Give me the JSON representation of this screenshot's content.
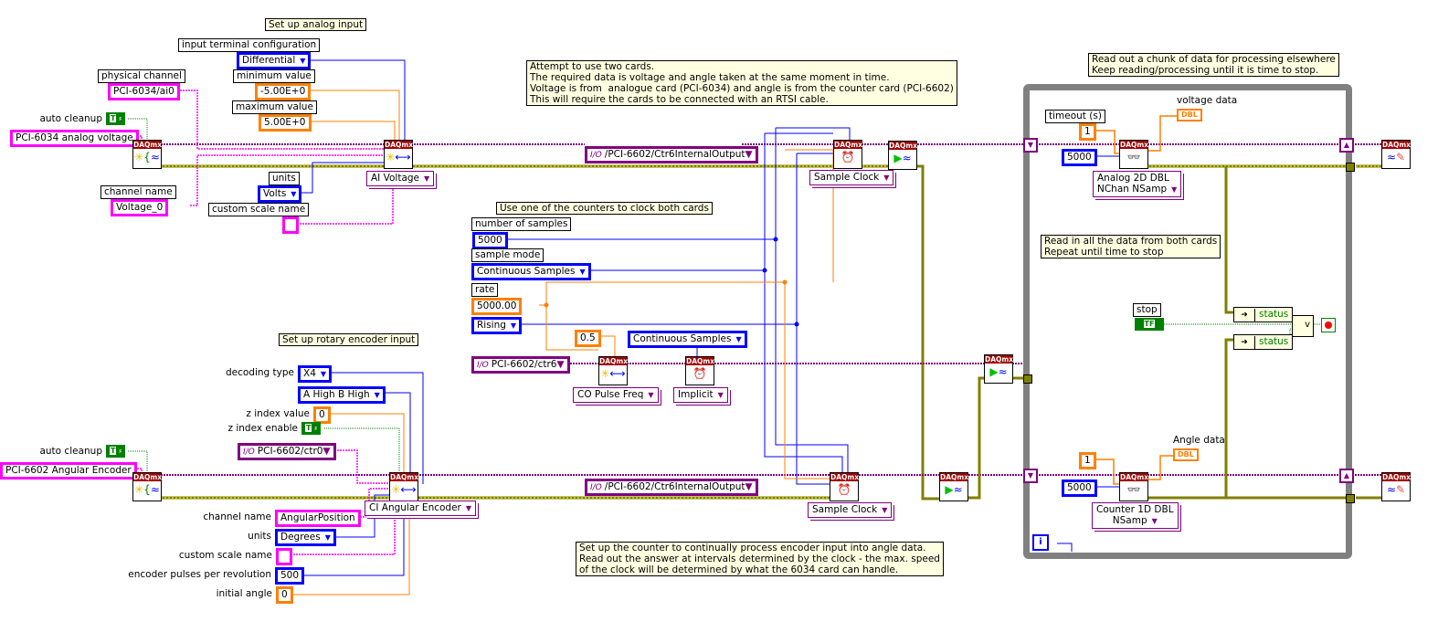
{
  "comments": {
    "setup_analog": "Set up analog input",
    "attempt": "Attempt to use two cards.\nThe required data is voltage and angle taken at the same moment in time.\nVoltage is from  analogue card (PCI-6034) and angle is from the counter card (PCI-6602)\nThis will require the cards to be connected with an RTSI cable.",
    "use_counters": "Use one of the counters to clock both cards",
    "setup_encoder": "Set up rotary encoder input",
    "counter_process": "Set up the counter to continually process encoder input into angle data.\nRead out the answer at intervals determined by the clock - the max. speed\nof the clock will be determined by what the 6034 card can handle.",
    "read_chunk": "Read out a chunk of data for processing elsewhere\nKeep reading/processing until it is time to stop.",
    "read_all": "Read in all the data from both cards\nRepeat until time to stop"
  },
  "analog": {
    "input_terminal_label": "input terminal configuration",
    "input_terminal_value": "Differential",
    "physical_channel_label": "physical channel",
    "physical_channel_value": "PCI-6034/ai0",
    "min_label": "minimum value",
    "min_value": "-5.00E+0",
    "max_label": "maximum value",
    "max_value": "5.00E+0",
    "auto_cleanup_label": "auto cleanup",
    "task_name": "PCI-6034 analog voltage",
    "units_label": "units",
    "units_value": "Volts",
    "channel_name_label": "channel name",
    "channel_name_value": "Voltage_0",
    "custom_scale_label": "custom scale name",
    "custom_scale_value": "",
    "create_channel_selector": "AI Voltage"
  },
  "clock": {
    "terminal_top": "/PCI-6602/Ctr6InternalOutput",
    "sample_clock_top": "Sample Clock",
    "num_samples_label": "number of samples",
    "num_samples_value": "5000",
    "sample_mode_label": "sample mode",
    "sample_mode_value": "Continuous Samples",
    "rate_label": "rate",
    "rate_value": "5000.00",
    "edge_value": "Rising",
    "duty_cycle": "0.5",
    "counter_channel": "PCI-6602/ctr6",
    "co_selector": "CO Pulse Freq",
    "implicit_mode": "Continuous Samples",
    "implicit_selector": "Implicit",
    "terminal_bottom": "/PCI-6602/Ctr6InternalOutput",
    "sample_clock_bottom": "Sample Clock"
  },
  "encoder": {
    "decoding_label": "decoding type",
    "decoding_value": "X4",
    "z_phase_value": "A High B High",
    "z_index_value_label": "z index value",
    "z_index_value": "0",
    "z_index_enable_label": "z index enable",
    "counter_channel": "PCI-6602/ctr0",
    "auto_cleanup_label": "auto cleanup",
    "task_name": "PCI-6602 Angular Encoder",
    "create_channel_selector": "CI Angular Encoder",
    "channel_name_label": "channel name",
    "channel_name_value": "AngularPosition",
    "units_label": "units",
    "units_value": "Degrees",
    "custom_scale_label": "custom scale name",
    "custom_scale_value": "",
    "pulses_label": "encoder pulses per revolution",
    "pulses_value": "500",
    "initial_angle_label": "initial angle",
    "initial_angle_value": "0"
  },
  "loop": {
    "timeout_label": "timeout (s)",
    "timeout_value_top": "1",
    "samples_top": "5000",
    "read_top_selector_l1": "Analog 2D DBL",
    "read_top_selector_l2": "NChan NSamp",
    "voltage_indicator_label": "voltage data",
    "indicator_type": "DBL",
    "timeout_value_bottom": "1",
    "samples_bottom": "5000",
    "read_bottom_selector_l1": "Counter 1D DBL",
    "read_bottom_selector_l2": "NSamp",
    "angle_indicator_label": "Angle data",
    "stop_label": "stop",
    "status_label": "status",
    "or_symbol": "v",
    "iteration_symbol": "i"
  },
  "vi": {
    "header": "DAQmx",
    "bool_true": "T",
    "bool_f": "F",
    "tf": "TF"
  },
  "colors": {
    "string_wire": "#ff00ff",
    "numeric_int_wire": "#0000ff",
    "numeric_dbl_wire": "#ff8000",
    "task_wire": "#800080",
    "error_wire": "#808000",
    "boolean_wire": "#008000",
    "comment_bg": "#ffffe1",
    "loop_border": "#808080"
  }
}
